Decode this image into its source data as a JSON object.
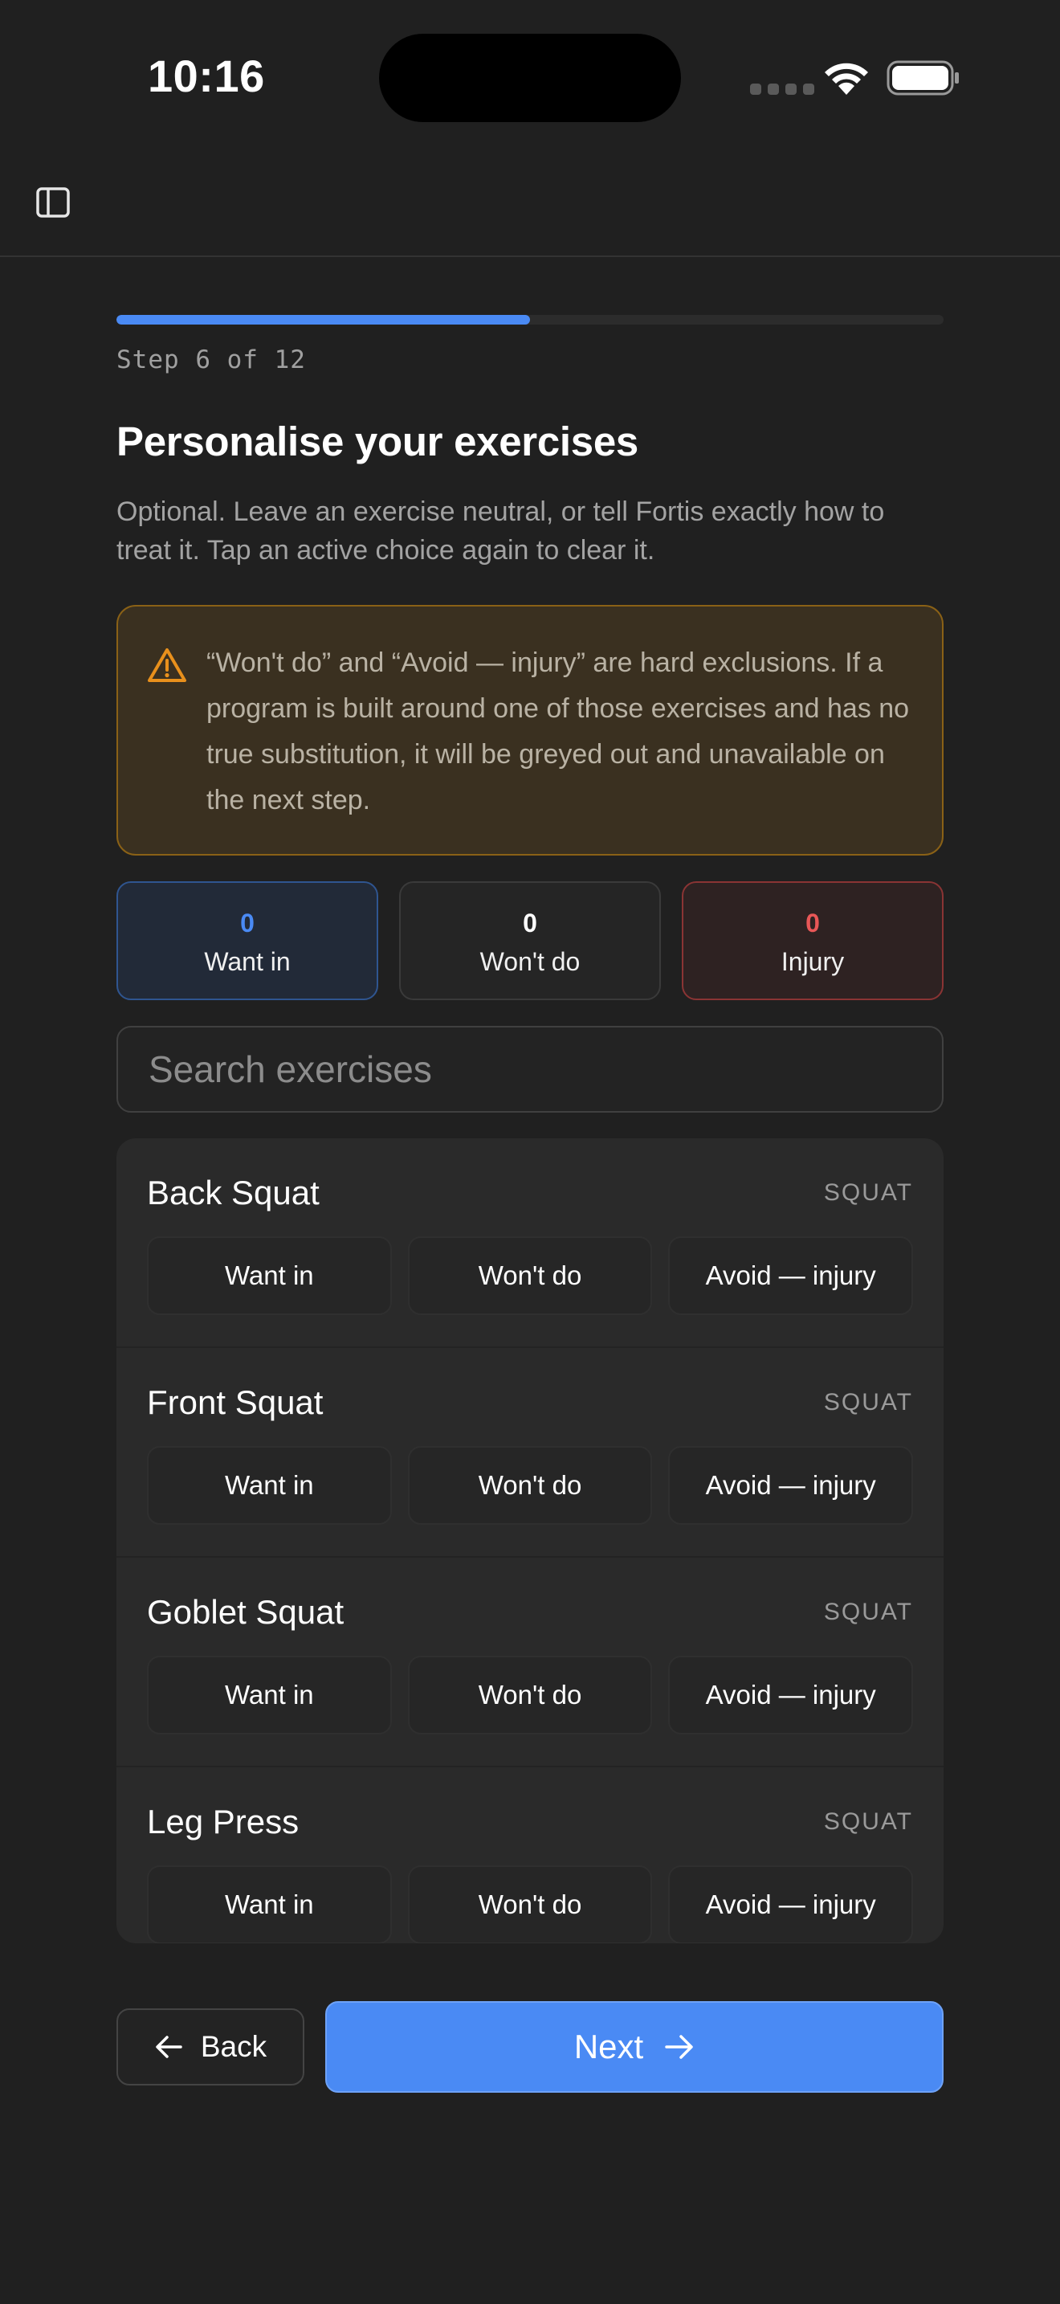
{
  "status_bar": {
    "time": "10:16"
  },
  "progress": {
    "step_label": "Step 6 of 12",
    "fraction": 0.5
  },
  "header": {
    "title": "Personalise your exercises",
    "subtitle": "Optional. Leave an exercise neutral, or tell Fortis exactly how to treat it. Tap an active choice again to clear it."
  },
  "warning": {
    "text": "“Won't do” and “Avoid — injury” are hard exclusions. If a program is built around one of those exercises and has no true substitution, it will be greyed out and unavailable on the next step."
  },
  "counters": [
    {
      "count": "0",
      "label": "Want in"
    },
    {
      "count": "0",
      "label": "Won't do"
    },
    {
      "count": "0",
      "label": "Injury"
    }
  ],
  "search": {
    "placeholder": "Search exercises",
    "value": ""
  },
  "exercises": [
    {
      "name": "Back Squat",
      "category": "SQUAT"
    },
    {
      "name": "Front Squat",
      "category": "SQUAT"
    },
    {
      "name": "Goblet Squat",
      "category": "SQUAT"
    },
    {
      "name": "Leg Press",
      "category": "SQUAT"
    }
  ],
  "choice_labels": {
    "want": "Want in",
    "wont": "Won't do",
    "avoid": "Avoid — injury"
  },
  "nav": {
    "back_label": "Back",
    "next_label": "Next"
  },
  "colors": {
    "accent": "#4a8af4",
    "warning_border": "#8a6116",
    "injury": "#e85757",
    "background": "#202020"
  }
}
